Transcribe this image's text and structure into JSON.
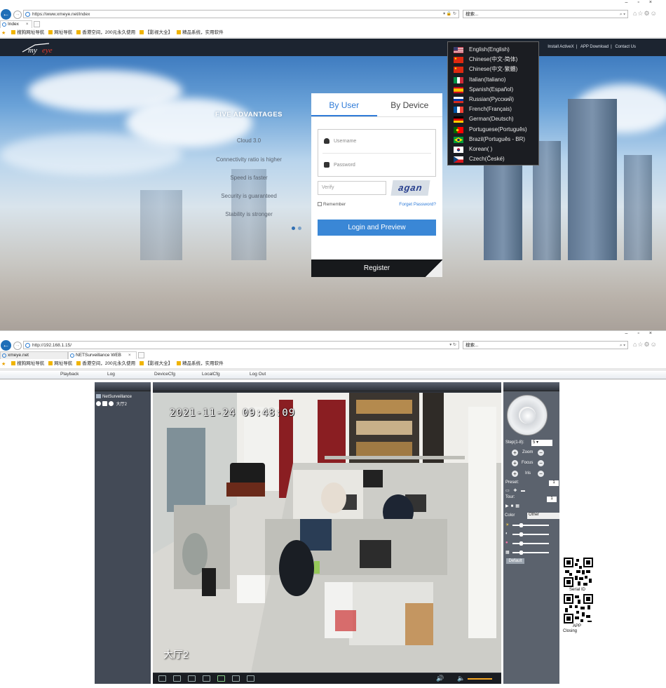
{
  "browser1": {
    "url": "https://www.xmeye.net/index",
    "search_placeholder": "搜索...",
    "tab_label": "Index",
    "bookmarks": [
      "搜狗网址导航",
      "网址导航",
      "香港空间，200元永久使用",
      "【影视大全】",
      "精品系统，实用软件"
    ]
  },
  "site": {
    "top_links": [
      "Install ActiveX",
      "APP Download",
      "Contact Us"
    ],
    "advantages_title": "FIVE ADVANTAGES",
    "advantages": [
      "Cloud 3.0",
      "Connectivity ratio is higher",
      "Speed is faster",
      "Security is guaranteed",
      "Stability is stronger"
    ],
    "login": {
      "tab_user": "By User",
      "tab_device": "By Device",
      "username_placeholder": "Username",
      "password_placeholder": "Password",
      "verify_placeholder": "Verify",
      "captcha_text": "agan",
      "remember": "Remember",
      "forgot": "Forget Password?",
      "login_button": "Login and Preview",
      "register_button": "Register"
    },
    "languages": [
      {
        "label": "English(English)",
        "flag": "us"
      },
      {
        "label": "Chinese(中文-简体)",
        "flag": "cn"
      },
      {
        "label": "Chinese(中文-繁體)",
        "flag": "cn"
      },
      {
        "label": "Italian(Italiano)",
        "flag": "it"
      },
      {
        "label": "Spanish(Español)",
        "flag": "es"
      },
      {
        "label": "Russian(Русский)",
        "flag": "ru"
      },
      {
        "label": "French(Français)",
        "flag": "fr"
      },
      {
        "label": "German(Deutsch)",
        "flag": "de"
      },
      {
        "label": "Portuguese(Português)",
        "flag": "pt"
      },
      {
        "label": "Brazil(Português - BR)",
        "flag": "br"
      },
      {
        "label": "Korean(        )",
        "flag": "kr"
      },
      {
        "label": "Czech(České)",
        "flag": "cz"
      }
    ]
  },
  "browser2": {
    "url": "http://192.168.1.15/",
    "search_placeholder": "搜索...",
    "tabs": [
      "xmeye.net",
      "NETSurveillance WEB"
    ],
    "bookmarks": [
      "搜狗网址导航",
      "网址导航",
      "香港空间，200元永久使用",
      "【影视大全】",
      "精品系统，实用软件"
    ]
  },
  "nvr": {
    "menu": [
      "Playback",
      "Log",
      "DeviceCfg",
      "LocalCfg",
      "Log Out"
    ],
    "device_name": "NetSurveillance",
    "channel_name": "大厅2",
    "osd_time": "2021-11-24 09:48:09",
    "osd_channel": "大厅2",
    "ptz": {
      "step_label": "Step(1-8):",
      "step_value": "5",
      "zoom": "Zoom",
      "focus": "Focus",
      "iris": "Iris",
      "preset": "Preset:",
      "preset_value": "1",
      "tour": "Tour:",
      "tour_value": "1",
      "tab_color": "Color",
      "tab_other": "Other",
      "default": "Default"
    },
    "qr_labels": [
      "Serial ID",
      "APP"
    ],
    "closing": "Closing"
  }
}
